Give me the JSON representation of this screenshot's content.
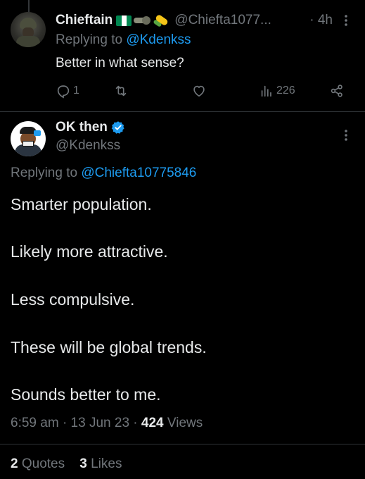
{
  "reply_tweet": {
    "display_name": "Chieftain",
    "handle": "@Chiefta1077...",
    "time": "· 4h",
    "replying_prefix": "Replying to",
    "replying_to": "@Kdenkss",
    "text": "Better in what sense?",
    "flag_colors": [
      "#008751",
      "#ffffff",
      "#008751"
    ],
    "icons": [
      "nigeria-flag-emoji",
      "tank-emoji",
      "corn-emoji",
      "more-icon"
    ],
    "actions": {
      "reply_count": "1",
      "retweet_count": "",
      "like_count": "",
      "views_count": "226"
    }
  },
  "main_tweet": {
    "display_name": "OK then",
    "handle": "@Kdenkss",
    "verified": true,
    "replying_prefix": "Replying to",
    "replying_to": "@Chiefta10775846",
    "lines": [
      "Smarter population.",
      "Likely more attractive.",
      "Less compulsive.",
      "These will be global trends.",
      "Sounds better to me."
    ],
    "time": "6:59 am",
    "date": "13 Jun 23",
    "views_count": "424",
    "views_label": "Views",
    "quotes_count": "2",
    "quotes_label": "Quotes",
    "likes_count": "3",
    "likes_label": "Likes"
  },
  "colors": {
    "background": "#000000",
    "text_primary": "#e7e9ea",
    "text_secondary": "#71767b",
    "accent": "#1d9bf0",
    "divider": "#2f3336"
  }
}
